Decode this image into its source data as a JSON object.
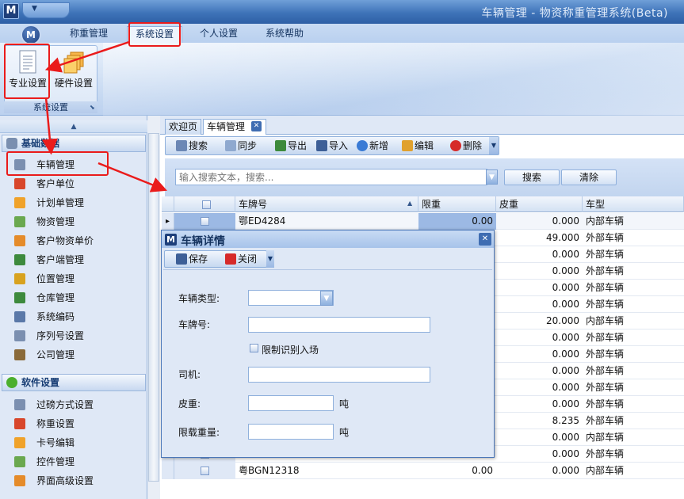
{
  "app": {
    "logo_letter": "M",
    "window_title": "车辆管理 - 物资称重管理系统(Beta)"
  },
  "ribbon": {
    "orb_letter": "M",
    "tabs": [
      "称重管理",
      "系统设置",
      "个人设置",
      "系统帮助"
    ],
    "group_label": "系统设置",
    "buttons": {
      "professional": "专业设置",
      "hardware": "硬件设置"
    }
  },
  "nav": {
    "section1": "基础数据",
    "section1_items": [
      "车辆管理",
      "客户单位",
      "计划单管理",
      "物资管理",
      "客户物资单价",
      "客户端管理",
      "位置管理",
      "仓库管理",
      "系统编码",
      "序列号设置",
      "公司管理"
    ],
    "section2": "软件设置",
    "section2_items": [
      "过磅方式设置",
      "称重设置",
      "卡号编辑",
      "控件管理",
      "界面高级设置"
    ]
  },
  "doc_tabs": [
    "欢迎页",
    "车辆管理"
  ],
  "toolbar": [
    "搜索",
    "同步",
    "导出",
    "导入",
    "新增",
    "编辑",
    "删除"
  ],
  "search": {
    "placeholder": "输入搜索文本，搜索...",
    "search_button": "搜索",
    "clear_button": "清除"
  },
  "grid": {
    "columns": [
      "车牌号",
      "限重",
      "皮重",
      "车型"
    ],
    "rows": [
      {
        "plate": "鄂ED4284",
        "limit": "0.00",
        "tare": "0.000",
        "type": "内部车辆"
      },
      {
        "plate": "",
        "limit": "",
        "tare": "49.000",
        "type": "外部车辆"
      },
      {
        "plate": "",
        "limit": "",
        "tare": "0.000",
        "type": "外部车辆"
      },
      {
        "plate": "",
        "limit": "",
        "tare": "0.000",
        "type": "外部车辆"
      },
      {
        "plate": "",
        "limit": "",
        "tare": "0.000",
        "type": "外部车辆"
      },
      {
        "plate": "",
        "limit": "",
        "tare": "0.000",
        "type": "外部车辆"
      },
      {
        "plate": "",
        "limit": "",
        "tare": "20.000",
        "type": "内部车辆"
      },
      {
        "plate": "",
        "limit": "",
        "tare": "0.000",
        "type": "外部车辆"
      },
      {
        "plate": "",
        "limit": "",
        "tare": "0.000",
        "type": "外部车辆"
      },
      {
        "plate": "",
        "limit": "",
        "tare": "0.000",
        "type": "外部车辆"
      },
      {
        "plate": "",
        "limit": "",
        "tare": "0.000",
        "type": "外部车辆"
      },
      {
        "plate": "",
        "limit": "",
        "tare": "0.000",
        "type": "外部车辆"
      },
      {
        "plate": "",
        "limit": "",
        "tare": "8.235",
        "type": "外部车辆"
      },
      {
        "plate": "",
        "limit": "",
        "tare": "0.000",
        "type": "内部车辆"
      },
      {
        "plate": "",
        "limit": "",
        "tare": "0.000",
        "type": "外部车辆"
      },
      {
        "plate": "粤BGN12318",
        "limit": "0.00",
        "tare": "0.000",
        "type": "内部车辆"
      }
    ]
  },
  "dialog": {
    "title": "车辆详情",
    "save": "保存",
    "close": "关闭",
    "labels": {
      "vehicle_type": "车辆类型:",
      "plate": "车牌号:",
      "limit_checkbox": "限制识别入场",
      "driver": "司机:",
      "tare": "皮重:",
      "max_load": "限载重量:"
    },
    "unit": "吨",
    "values": {
      "vehicle_type": "",
      "plate": "",
      "driver": "",
      "tare": "",
      "max_load": ""
    }
  }
}
